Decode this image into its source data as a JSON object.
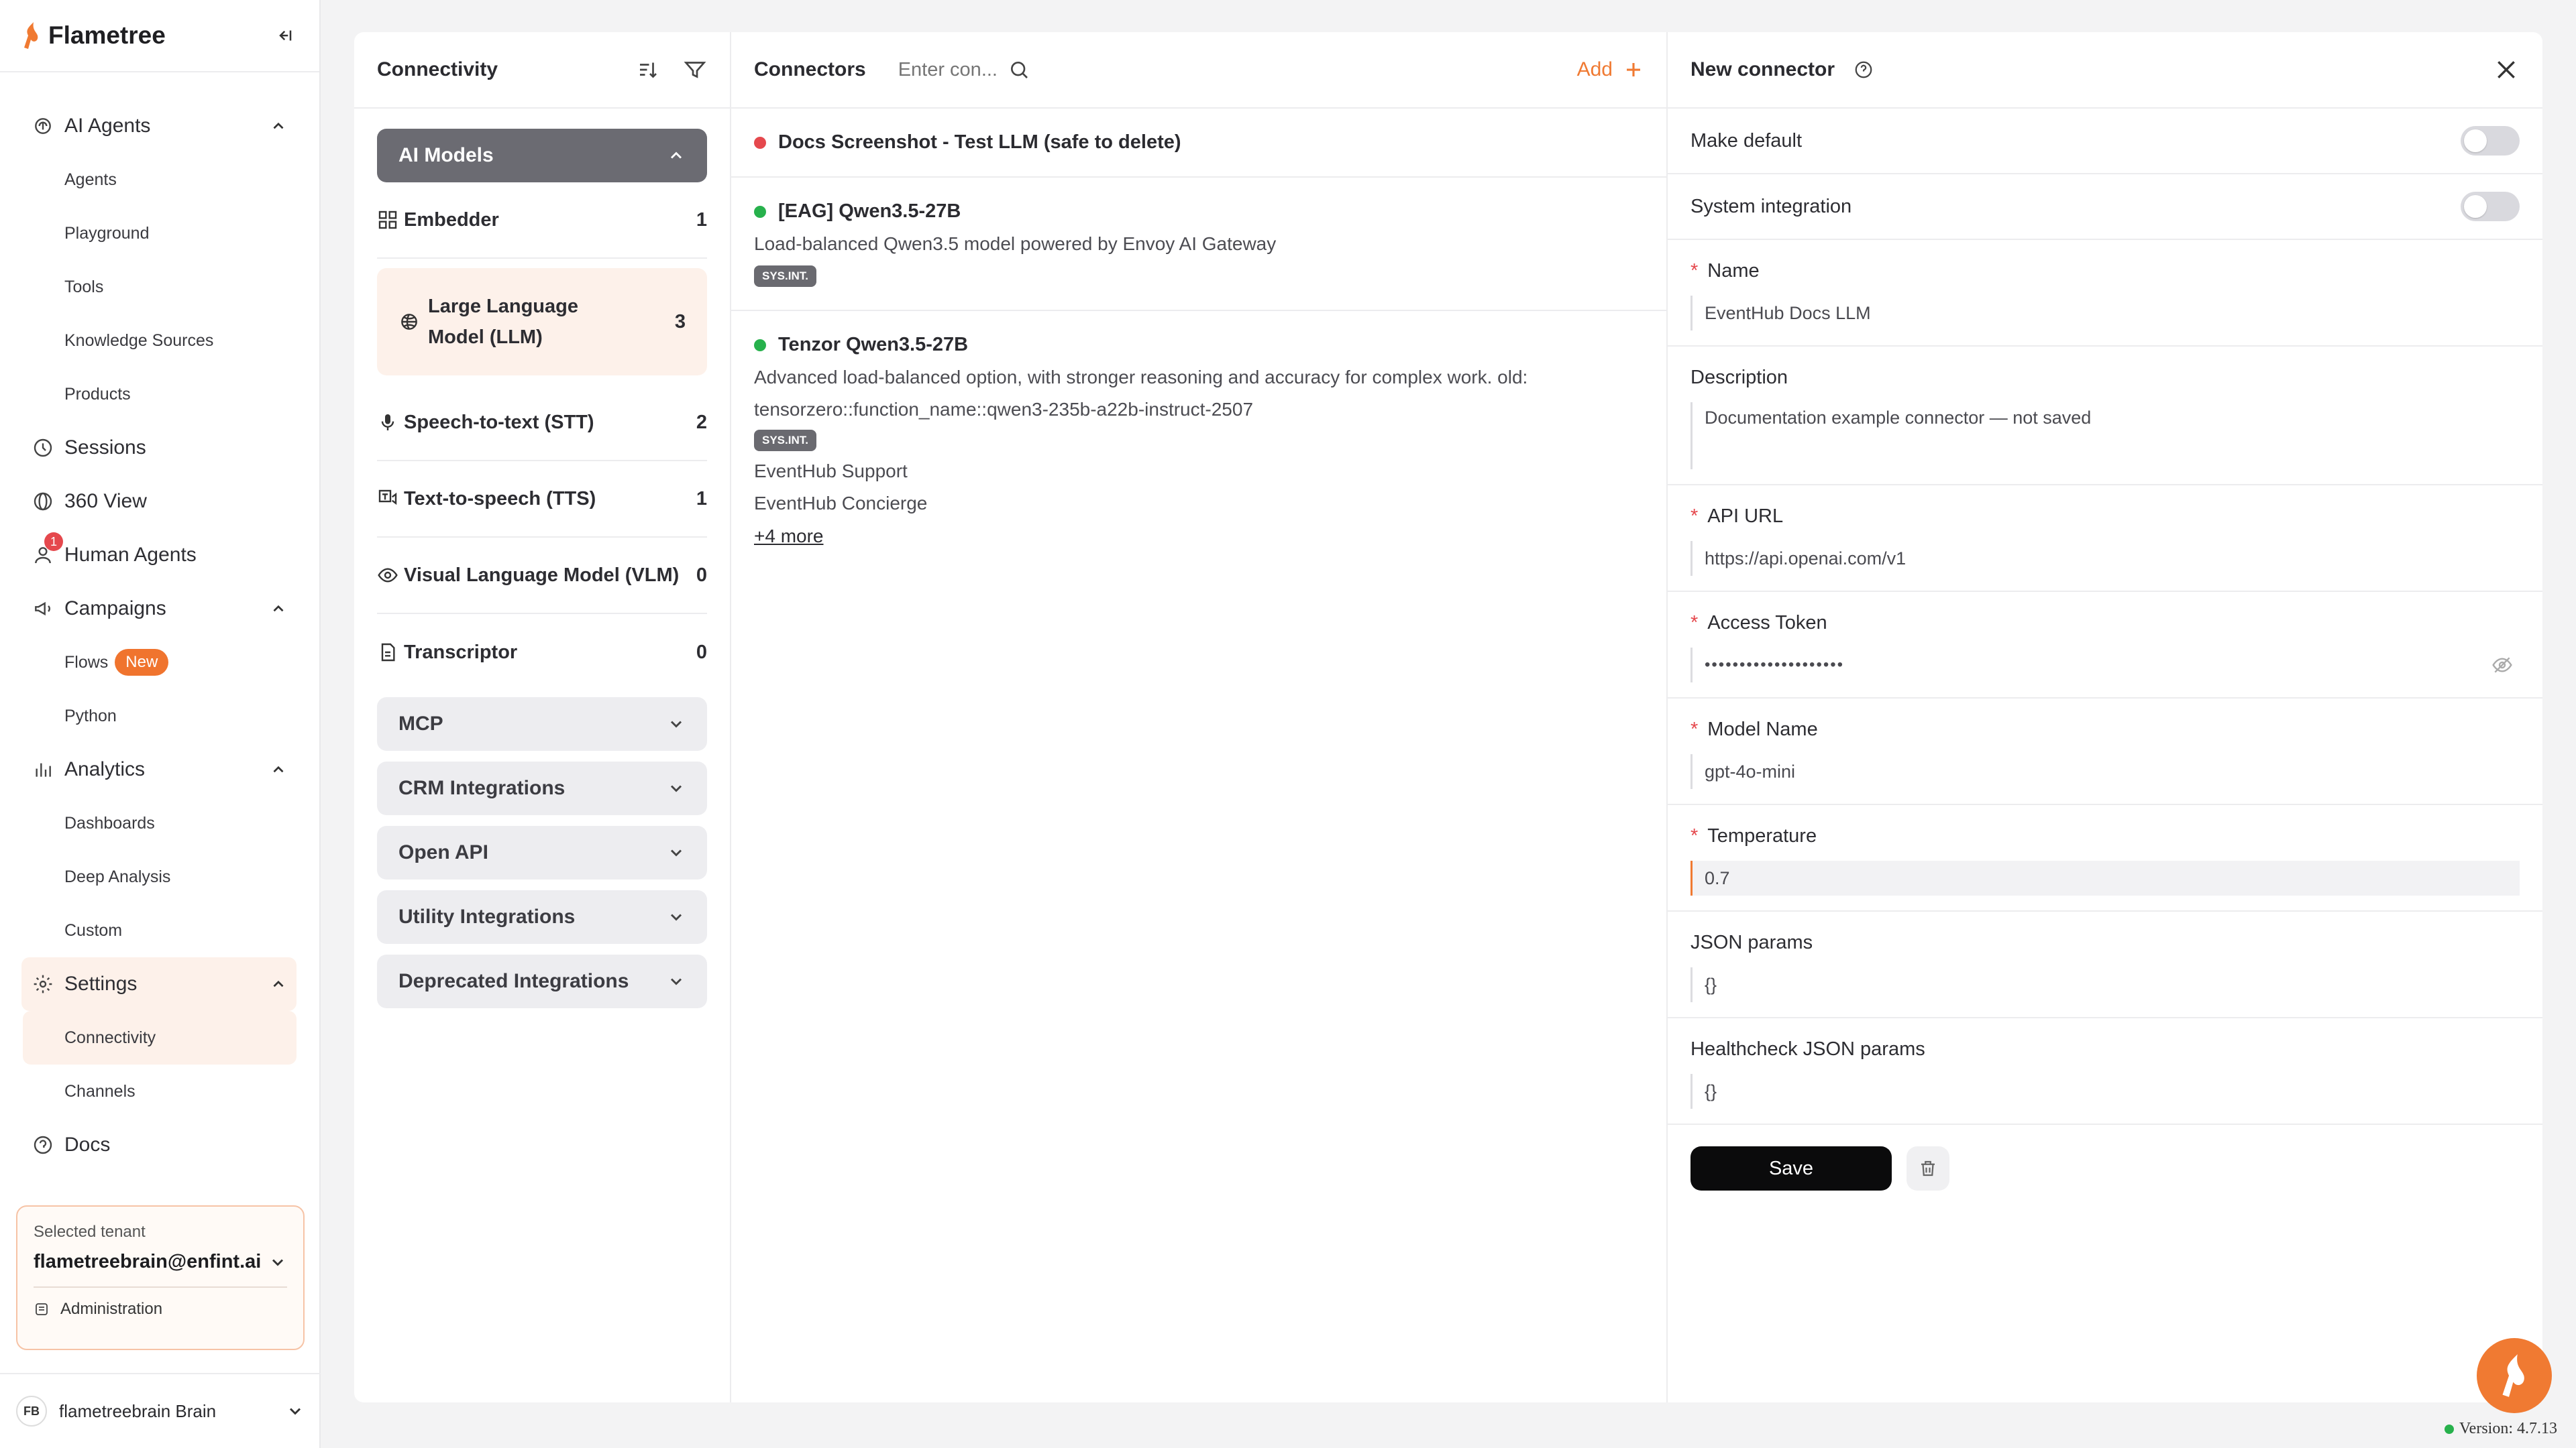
{
  "app": {
    "name": "Flametree"
  },
  "sidebar": {
    "ai_agents": {
      "label": "AI Agents",
      "items": [
        "Agents",
        "Playground",
        "Tools",
        "Knowledge Sources",
        "Products"
      ]
    },
    "sessions": "Sessions",
    "view360": "360 View",
    "human_agents": {
      "label": "Human Agents",
      "notifications": "1"
    },
    "campaigns": {
      "label": "Campaigns",
      "items": [
        "Flows",
        "Python"
      ],
      "new_badge": "New"
    },
    "analytics": {
      "label": "Analytics",
      "items": [
        "Dashboards",
        "Deep Analysis",
        "Custom"
      ]
    },
    "settings": {
      "label": "Settings",
      "items": [
        "Connectivity",
        "Channels"
      ]
    },
    "docs": "Docs",
    "tenant": {
      "label": "Selected tenant",
      "value": "flametreebrain@enfint.ai",
      "admin": "Administration"
    },
    "user": {
      "initials": "FB",
      "name": "flametreebrain Brain"
    }
  },
  "connectivity": {
    "title": "Connectivity",
    "groups": {
      "ai_models": "AI Models",
      "mcp": "MCP",
      "crm": "CRM Integrations",
      "open_api": "Open API",
      "utility": "Utility Integrations",
      "deprecated": "Deprecated Integrations"
    },
    "categories": [
      {
        "label": "Embedder",
        "count": "1"
      },
      {
        "label": "Large Language Model (LLM)",
        "count": "3"
      },
      {
        "label": "Speech-to-text (STT)",
        "count": "2"
      },
      {
        "label": "Text-to-speech (TTS)",
        "count": "1"
      },
      {
        "label": "Visual Language Model (VLM)",
        "count": "0"
      },
      {
        "label": "Transcriptor",
        "count": "0"
      }
    ]
  },
  "connectors": {
    "title": "Connectors",
    "search_placeholder": "Enter con...",
    "add_label": "Add",
    "items": [
      {
        "name": "Docs Screenshot - Test LLM (safe to delete)",
        "status_color": "#e5484d"
      },
      {
        "name": "[EAG] Qwen3.5-27B",
        "status_color": "#27b14c",
        "description": "Load-balanced Qwen3.5 model powered by Envoy AI Gateway",
        "badge": "SYS.INT."
      },
      {
        "name": "Tenzor Qwen3.5-27B",
        "status_color": "#27b14c",
        "description": "Advanced load-balanced option, with stronger reasoning and accuracy for complex work. old: tensorzero::function_name::qwen3-235b-a22b-instruct-2507",
        "badge": "SYS.INT.",
        "agents": [
          "EventHub Support",
          "EventHub Concierge"
        ],
        "more": "+4 more"
      }
    ]
  },
  "form": {
    "title": "New connector",
    "make_default": "Make default",
    "system_integration": "System integration",
    "name": {
      "label": "Name",
      "value": "EventHub Docs LLM"
    },
    "description": {
      "label": "Description",
      "value": "Documentation example connector — not saved"
    },
    "api_url": {
      "label": "API URL",
      "value": "https://api.openai.com/v1"
    },
    "access_token": {
      "label": "Access Token",
      "value": "••••••••••••••••••••"
    },
    "model_name": {
      "label": "Model Name",
      "value": "gpt-4o-mini"
    },
    "temperature": {
      "label": "Temperature",
      "value": "0.7"
    },
    "json_params": {
      "label": "JSON params",
      "value": "{}"
    },
    "healthcheck_params": {
      "label": "Healthcheck JSON params",
      "value": "{}"
    },
    "save_label": "Save"
  },
  "version": "Version: 4.7.13",
  "colors": {
    "accent": "#f07a32",
    "ok": "#27b14c",
    "error": "#e5484d"
  }
}
